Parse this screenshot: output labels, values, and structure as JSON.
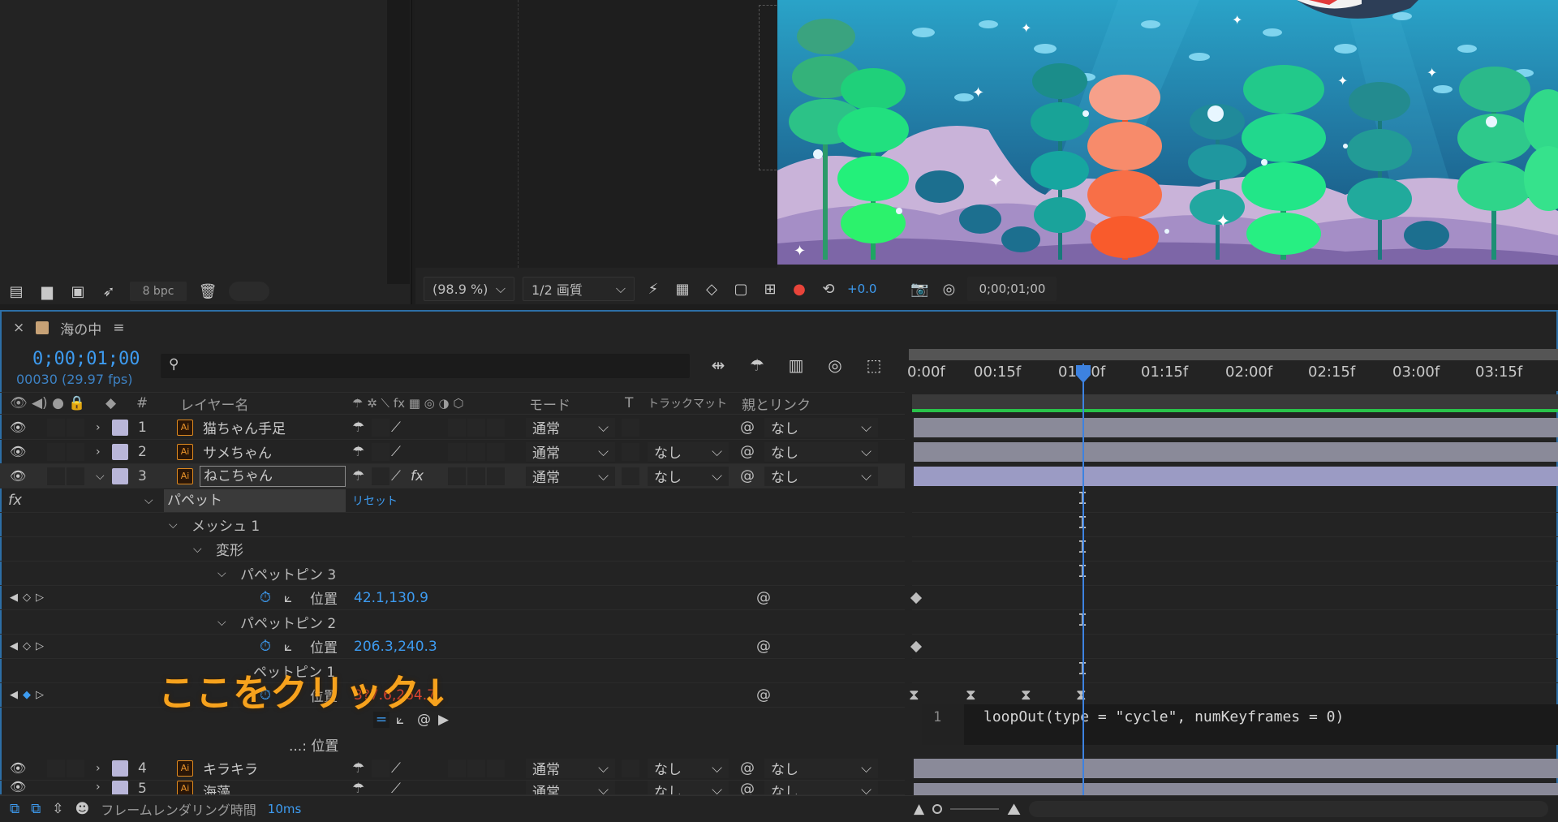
{
  "project": {
    "bpc_label": "8 bpc"
  },
  "viewer_toolbar": {
    "zoom_value": "(98.9 %)",
    "quality_value": "1/2 画質",
    "exposure_value": "+0.0",
    "time_display": "0;00;01;00"
  },
  "timeline": {
    "comp_tab": "海の中",
    "current_time": "0;00;01;00",
    "current_frame": "00030 (29.97 fps)",
    "columns": {
      "number": "#",
      "layer_name": "レイヤー名",
      "mode": "モード",
      "t": "T",
      "track_matte": "トラックマット",
      "parent": "親とリンク"
    },
    "layers": [
      {
        "num": "1",
        "name": "猫ちゃん手足",
        "mode": "通常",
        "track": "",
        "parent": "なし"
      },
      {
        "num": "2",
        "name": "サメちゃん",
        "mode": "通常",
        "track": "なし",
        "parent": "なし"
      },
      {
        "num": "3",
        "name": "ねこちゃん",
        "mode": "通常",
        "track": "なし",
        "parent": "なし"
      },
      {
        "num": "4",
        "name": "キラキラ",
        "mode": "通常",
        "track": "なし",
        "parent": "なし"
      },
      {
        "num": "5",
        "name": "海藻",
        "mode": "通常",
        "track": "なし",
        "parent": "なし"
      }
    ],
    "properties": {
      "fx_badge": "fx",
      "puppet": "パペット",
      "reset": "リセット",
      "mesh": "メッシュ 1",
      "deform": "変形",
      "pin3": "パペットピン 3",
      "pin3_position_label": "位置",
      "pin3_position_value": "42.1,130.9",
      "pin2": "パペットピン 2",
      "pin2_position_label": "位置",
      "pin2_position_value": "206.3,240.3",
      "pin1_partial": "ペットピン 1",
      "pin1_position_label": "位置",
      "pin1_position_value": "3?7.6,264.7",
      "expression_label": "...: 位置"
    },
    "ruler": [
      "0:00f",
      "00:15f",
      "01:00f",
      "01:15f",
      "02:00f",
      "02:15f",
      "03:00f",
      "03:15f"
    ],
    "expression": {
      "line_number": "1",
      "code": "loopOut(type = \"cycle\", numKeyframes = 0)"
    },
    "status": {
      "render_label": "フレームレンダリング時間",
      "render_time": "10ms"
    }
  },
  "annotation": "ここをクリック↓",
  "colors": {
    "accent_blue": "#3d9bf0",
    "annotation_orange": "#f7a21d",
    "work_area_green": "#29c34a"
  }
}
